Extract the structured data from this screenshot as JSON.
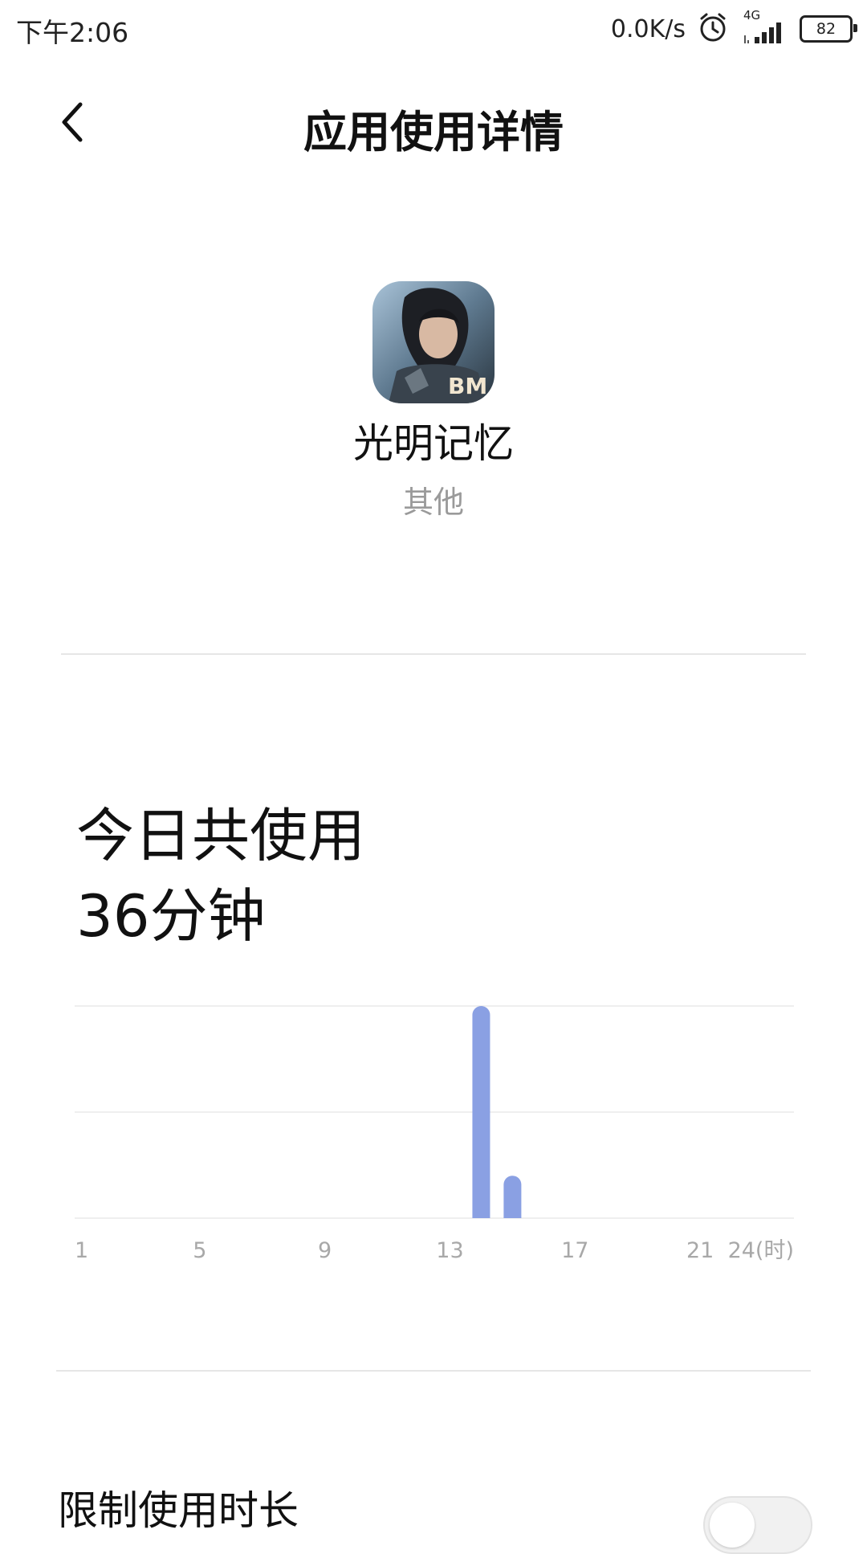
{
  "status_bar": {
    "time": "下午2:06",
    "net_speed": "0.0K/s",
    "network_type": "4G",
    "battery": "82",
    "icons": [
      "alarm-icon",
      "signal-icon",
      "battery-icon"
    ]
  },
  "header": {
    "title": "应用使用详情",
    "back_icon": "back-chevron-icon"
  },
  "app": {
    "name": "光明记忆",
    "category": "其他",
    "icon_badge": "BM"
  },
  "usage": {
    "label": "今日共使用",
    "duration": "36分钟"
  },
  "chart_data": {
    "type": "bar",
    "x_ticks": [
      "1",
      "5",
      "9",
      "13",
      "17",
      "21",
      "24(时)"
    ],
    "x_range": [
      1,
      24
    ],
    "series": [
      {
        "x": [
          14,
          15
        ],
        "values": [
          1.0,
          0.2
        ]
      }
    ],
    "ylim": [
      0,
      1
    ],
    "grid": true,
    "bar_color": "#8aa0e3"
  },
  "limit": {
    "label": "限制使用时长",
    "enabled": false
  },
  "colors": {
    "accent": "#8aa0e3",
    "secondary_text": "#9a9a9a",
    "divider": "#e6e6e6"
  }
}
